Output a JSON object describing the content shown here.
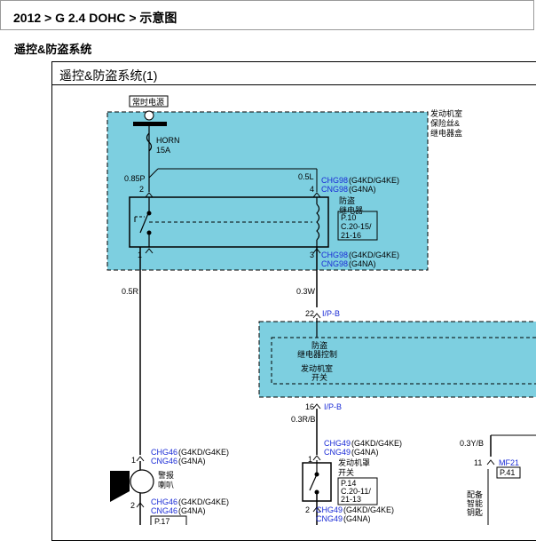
{
  "breadcrumb": "2012 > G 2.4 DOHC > 示意图",
  "section_title": "遥控&防盗系统",
  "diagram": {
    "title": "遥控&防盗系统(1)",
    "power_label": "常时电源",
    "fuse_name": "HORN",
    "fuse_rating": "15A",
    "top_box_label": [
      "发动机室",
      "保险丝&",
      "继电器盒"
    ],
    "wire_085p": "0.85P",
    "wire_05l": "0.5L",
    "pin_2": "2",
    "pin_4": "4",
    "pin_1": "1",
    "pin_3": "3",
    "conn_top_a": "CHG98",
    "conn_top_a_spec": "(G4KD/G4KE)",
    "conn_top_b": "CNG98",
    "conn_top_b_spec": "(G4NA)",
    "relay_label": [
      "防盗",
      "继电器"
    ],
    "relay_ref": [
      "P.10",
      "C.20-15/",
      "21-16"
    ],
    "conn_bot_a": "CHG98",
    "conn_bot_a_spec": "(G4KD/G4KE)",
    "conn_bot_b": "CNG98",
    "conn_bot_b_spec": "(G4NA)",
    "wire_05r": "0.5R",
    "wire_03w": "0.3W",
    "ipb_pin_22": "22",
    "ipb_conn_top": "I/P-B",
    "control_label": [
      "防盗",
      "继电器控制"
    ],
    "engine_switch_label": [
      "发动机室",
      "开关"
    ],
    "ipb_pin_16": "16",
    "ipb_conn_bot": "I/P-B",
    "wire_03rb": "0.3R/B",
    "wire_03yb": "0.3Y/B",
    "horn_pin_1": "1",
    "horn_conn_a": "CHG46",
    "horn_conn_a_spec": "(G4KD/G4KE)",
    "horn_conn_b": "CNG46",
    "horn_conn_b_spec": "(G4NA)",
    "horn_label": [
      "警报",
      "喇叭"
    ],
    "horn_pin_2": "2",
    "horn_conn2_a": "CHG46",
    "horn_conn2_a_spec": "(G4KD/G4KE)",
    "horn_conn2_b": "CNG46",
    "horn_conn2_b_spec": "(G4NA)",
    "horn_ref": "P.17",
    "sw_pin_1": "1",
    "sw_conn_a": "CHG49",
    "sw_conn_a_spec": "(G4KD/G4KE)",
    "sw_conn_b": "CNG49",
    "sw_conn_b_spec": "(G4NA)",
    "sw_label": [
      "发动机罩",
      "开关"
    ],
    "sw_ref": [
      "P.14",
      "C.20-11/",
      "21-13"
    ],
    "sw_pin_2": "2",
    "sw_conn2_a": "CHG49",
    "sw_conn2_a_spec": "(G4KD/G4KE)",
    "sw_conn2_b": "CNG49",
    "sw_conn2_b_spec": "(G4NA)",
    "mf_pin": "11",
    "mf_conn": "MF21",
    "mf_ref": "P.41",
    "smart_key_label": [
      "配备",
      "智能",
      "钥匙"
    ]
  },
  "colors": {
    "box_fill": "#7dcfe0",
    "connector_blue": "#1a2bd6",
    "line": "#000000"
  }
}
